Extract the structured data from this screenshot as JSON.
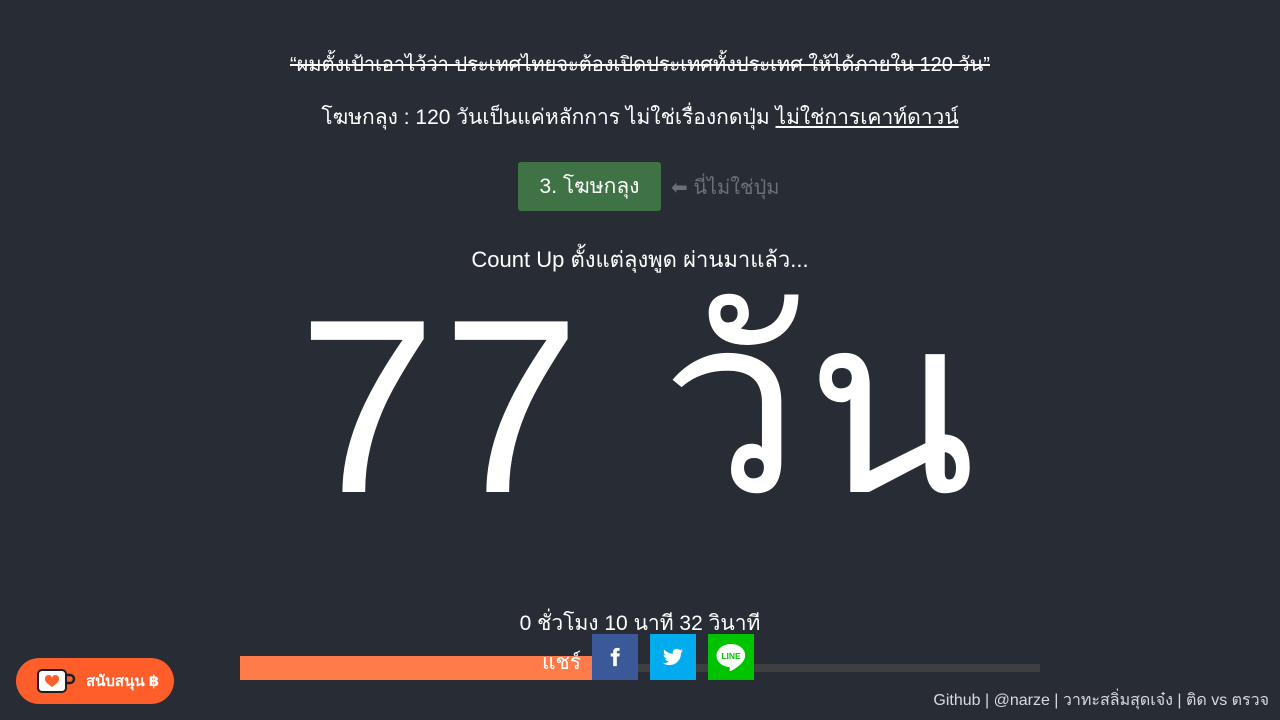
{
  "quote": "“ผมตั้งเป้าเอาไว้ว่า ประเทศไทยจะต้องเปิดประเทศทั้งประเทศ ให้ได้ภายใน 120 วัน”",
  "subline": {
    "prefix": "โฆษกลุง : 120 วันเป็นแค่หลักการ ไม่ใช่เรื่องกดปุ่ม",
    "link": "ไม่ใช่การเคาท์ดาวน์"
  },
  "speaker_button": "3. โฆษกลุง",
  "not_button_note": "⬅ นี่ไม่ใช่ปุ่ม",
  "countup_label": "Count Up ตั้งแต่ลุงพูด ผ่านมาแล้ว...",
  "big_days": "77 วัน",
  "time_rest": "0 ชั่วโมง 10 นาที 32 วินาที",
  "progress": {
    "fraction": 0.4965,
    "fill_color": "#ff7b4a",
    "track_color": "#3e3f41"
  },
  "share": {
    "label": "แชร์",
    "icons": [
      "facebook-icon",
      "twitter-icon",
      "line-icon"
    ]
  },
  "support_button": "สนับสนุน ฿",
  "footer": {
    "links": [
      "Github",
      "@narze",
      "วาทะสลิ่มสุดเจ๋ง",
      "ติด vs ตรวจ"
    ],
    "separator": " | "
  },
  "colors": {
    "background": "#282c34",
    "speaker_button": "#3f7244",
    "support_button": "#ff5e2b",
    "facebook": "#3b5998",
    "twitter": "#00aced",
    "line": "#00c300"
  }
}
